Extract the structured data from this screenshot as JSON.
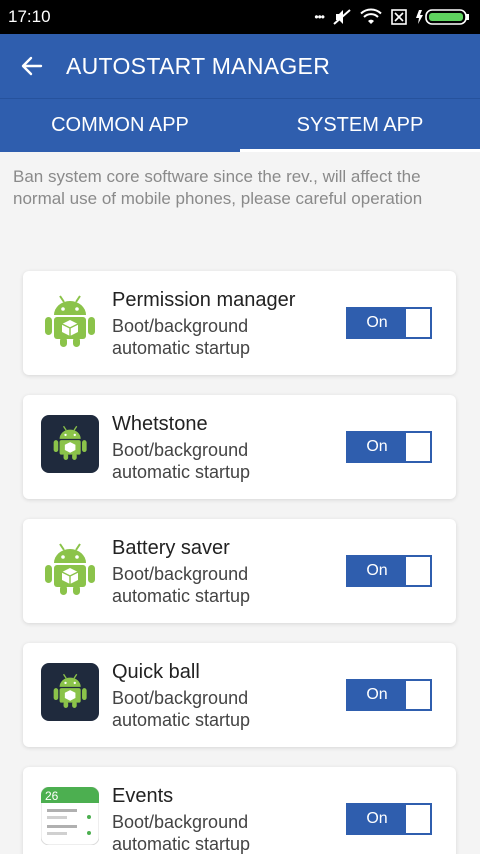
{
  "status": {
    "time": "17:10",
    "dots": "•••"
  },
  "header": {
    "title": "AUTOSTART MANAGER"
  },
  "tabs": [
    {
      "label": "COMMON APP",
      "active": false
    },
    {
      "label": "SYSTEM APP",
      "active": true
    }
  ],
  "notice": "Ban system core software since the rev., will affect the normal use of mobile phones, please careful operation",
  "apps": [
    {
      "name": "Permission manager",
      "subtitle_line1": "Boot/background",
      "subtitle_line2": "automatic startup",
      "toggle": "On",
      "icon": "android-robot-icon"
    },
    {
      "name": "Whetstone",
      "subtitle_line1": "Boot/background",
      "subtitle_line2": "automatic startup",
      "toggle": "On",
      "icon": "android-robot-dark-icon"
    },
    {
      "name": "Battery saver",
      "subtitle_line1": "Boot/background",
      "subtitle_line2": "automatic startup",
      "toggle": "On",
      "icon": "android-robot-icon"
    },
    {
      "name": "Quick ball",
      "subtitle_line1": "Boot/background",
      "subtitle_line2": "automatic startup",
      "toggle": "On",
      "icon": "android-robot-dark-icon"
    },
    {
      "name": "Events",
      "subtitle_line1": "Boot/background",
      "subtitle_line2": "automatic startup",
      "toggle": "On",
      "icon": "calendar-events-icon",
      "icon_date": "26"
    }
  ],
  "colors": {
    "primary": "#2f5eae",
    "android_green": "#8bc34a",
    "dark_icon_bg": "#1f2a3d"
  }
}
